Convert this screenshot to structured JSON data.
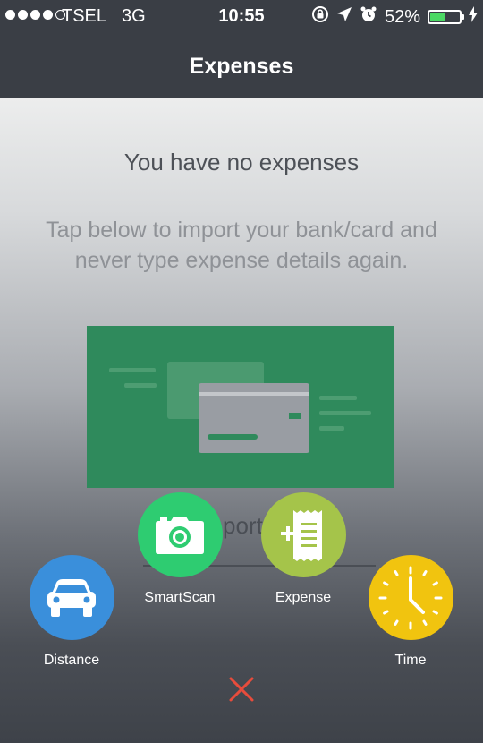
{
  "status_bar": {
    "carrier": "TSEL",
    "network": "3G",
    "time": "10:55",
    "battery": "52%",
    "battery_level": 0.52
  },
  "nav": {
    "title": "Expenses"
  },
  "empty_state": {
    "title": "You have no expenses",
    "subtitle": "Tap below to import your bank/card and never type expense details again.",
    "import_label": "Import C"
  },
  "actions": {
    "distance": {
      "label": "Distance",
      "color": "#3a8fdb",
      "icon": "car-icon"
    },
    "smartscan": {
      "label": "SmartScan",
      "color": "#2ecc71",
      "icon": "camera-icon"
    },
    "expense": {
      "label": "Expense",
      "color": "#a5c44a",
      "icon": "receipt-plus-icon"
    },
    "time": {
      "label": "Time",
      "color": "#f1c40f",
      "icon": "clock-icon"
    }
  },
  "close": {
    "icon": "close-icon",
    "color": "#e74c3c"
  }
}
